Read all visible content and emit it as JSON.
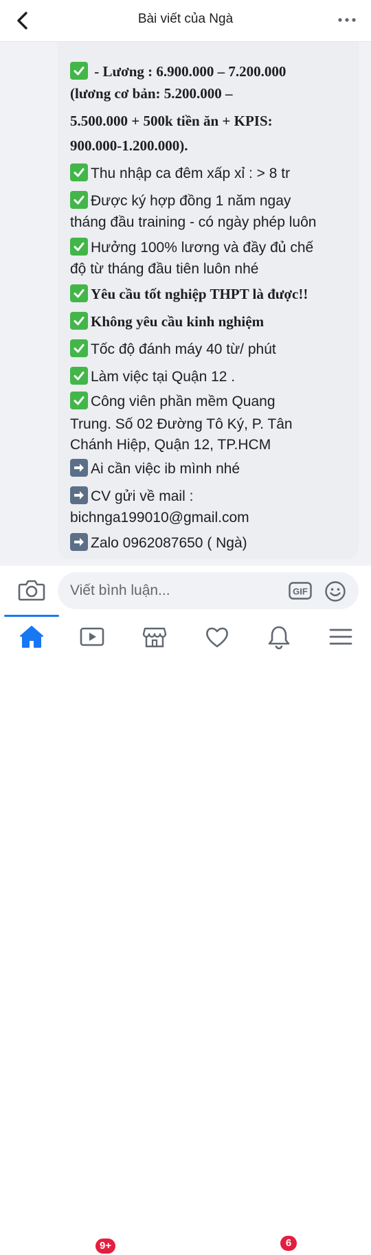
{
  "header": {
    "title": "Bài viết của Ngà",
    "back_icon": "chevron-left-icon",
    "more_icon": "more-horizontal-icon"
  },
  "post": {
    "lines": [
      {
        "icon": "check-icon",
        "text": " - Lương : 6.900.000 – 7.200.000",
        "style": "serif"
      },
      {
        "icon": "",
        "text": "(lương cơ bản: 5.200.000 –",
        "style": "serif"
      },
      {
        "icon": "",
        "text": "5.500.000 + 500k tiền ăn + KPIS:",
        "style": "serif"
      },
      {
        "icon": "",
        "text": "900.000-1.200.000).",
        "style": "serif"
      },
      {
        "icon": "check-icon",
        "text": "Thu nhập ca đêm  xấp xỉ : > 8 tr",
        "style": "sans"
      },
      {
        "icon": "check-icon",
        "text": "Được ký hợp đồng 1 năm ngay",
        "style": "sans"
      },
      {
        "icon": "",
        "text": "tháng đầu training - có ngày phép luôn",
        "style": "sans"
      },
      {
        "icon": "check-icon",
        "text": "Hưởng 100% lương và đầy đủ chế",
        "style": "sans"
      },
      {
        "icon": "",
        "text": "độ từ tháng đầu tiên luôn nhé",
        "style": "sans"
      },
      {
        "icon": "check-icon",
        "text": "Yêu cầu tốt nghiệp THPT là được!!",
        "style": "serif"
      },
      {
        "icon": "check-icon",
        "text": "Không yêu cầu kinh nghiệm",
        "style": "serif"
      },
      {
        "icon": "check-icon",
        "text": "Tốc độ đánh máy 40 từ/ phút",
        "style": "sans"
      },
      {
        "icon": "check-icon",
        "text": "Làm việc tại Quận 12 .",
        "style": "sans"
      },
      {
        "icon": "check-icon",
        "text": "Công viên phần mềm Quang",
        "style": "sans"
      },
      {
        "icon": "",
        "text": "Trung. Số 02 Đường Tô Ký, P. Tân",
        "style": "sans"
      },
      {
        "icon": "",
        "text": "Chánh Hiệp, Quận 12, TP.HCM",
        "style": "sans"
      },
      {
        "icon": "arrow-right-icon",
        "text": "Ai cần việc ib mình nhé",
        "style": "sans"
      },
      {
        "icon": "arrow-right-icon",
        "text": "CV gửi về mail :",
        "style": "sans"
      },
      {
        "icon": "",
        "text": "bichnga199010@gmail.com",
        "style": "sans"
      },
      {
        "icon": "arrow-right-icon",
        "text": "Zalo 0962087650 ( Ngà)",
        "style": "sans"
      }
    ]
  },
  "composer": {
    "placeholder": "Viết bình luận...",
    "gif_label": "GIF",
    "camera_icon": "camera-icon",
    "emoji_icon": "smile-icon"
  },
  "tabbar": {
    "tabs": [
      {
        "name": "home",
        "icon": "home-icon",
        "badge": ""
      },
      {
        "name": "watch",
        "icon": "video-icon",
        "badge": "9+"
      },
      {
        "name": "marketplace",
        "icon": "store-icon",
        "badge": ""
      },
      {
        "name": "dating",
        "icon": "heart-icon",
        "badge": ""
      },
      {
        "name": "notifications",
        "icon": "bell-icon",
        "badge": "6"
      },
      {
        "name": "menu",
        "icon": "menu-icon",
        "badge": ""
      }
    ]
  },
  "colors": {
    "accent": "#1877f2",
    "check": "#43b649",
    "badge": "#e41e3f",
    "bubble": "#eceef1"
  }
}
